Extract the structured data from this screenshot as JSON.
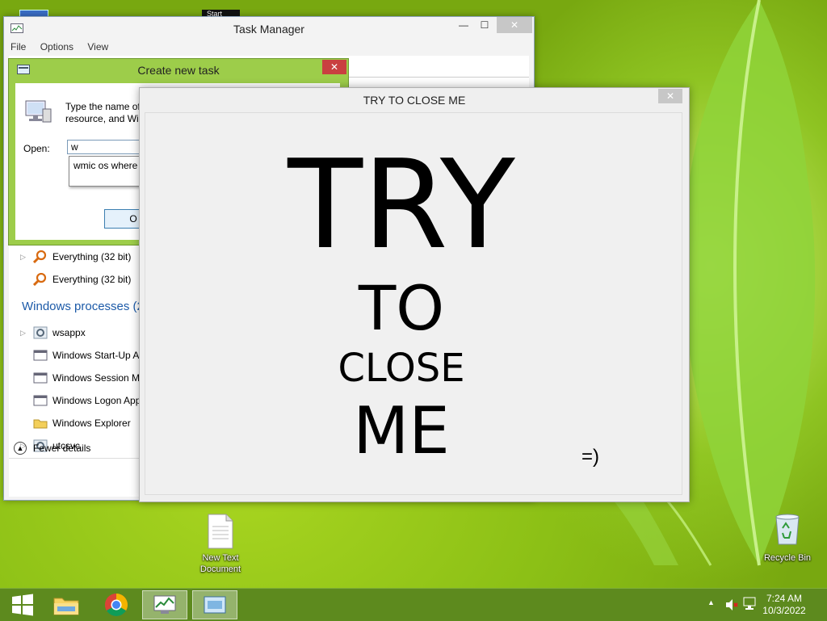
{
  "desktop": {
    "start_tooltip": "Start",
    "icons": {
      "new_text_document": "New Text\nDocument",
      "recycle_bin": "Recycle Bin"
    }
  },
  "task_manager": {
    "title": "Task Manager",
    "controls": {
      "minimize": "—",
      "maximize": "☐",
      "close": "✕"
    },
    "menu": [
      "File",
      "Options",
      "View"
    ],
    "processes": [
      {
        "name": "Everything (32 bit)",
        "icon": "magnifier-icon",
        "expandable": true
      },
      {
        "name": "Everything (32 bit)",
        "icon": "magnifier-icon",
        "expandable": false
      }
    ],
    "windows_processes_header": "Windows processes (2",
    "windows_processes": [
      {
        "name": "wsappx",
        "icon": "gear-icon",
        "expandable": true
      },
      {
        "name": "Windows Start-Up Ap",
        "icon": "window-icon",
        "expandable": false
      },
      {
        "name": "Windows Session Ma",
        "icon": "window-icon",
        "expandable": false
      },
      {
        "name": "Windows Logon App",
        "icon": "window-icon",
        "expandable": false
      },
      {
        "name": "Windows Explorer",
        "icon": "folder-icon",
        "expandable": false
      },
      {
        "name": "utcsvc",
        "icon": "gear-icon",
        "expandable": true
      }
    ],
    "fewer_details": "Fewer details"
  },
  "create_new_task": {
    "title": "Create new task",
    "close": "✕",
    "description": "Type the name of\nresource, and Win",
    "open_label": "Open:",
    "input_value": "w",
    "suggestion": "wmic os where",
    "ok_label": "O"
  },
  "try_window": {
    "title": "TRY TO CLOSE ME",
    "close": "✕",
    "line1": "TRY",
    "line2": "TO",
    "line3": "CLOSE",
    "line4": "ME",
    "smiley": "=)"
  },
  "taskbar": {
    "time": "7:24 AM",
    "date": "10/3/2022"
  },
  "colors": {
    "taskbar": "#5d8a1e",
    "dialog_frame": "#9dcd4a",
    "close_red": "#c94040",
    "section_blue": "#1c5aa8"
  }
}
